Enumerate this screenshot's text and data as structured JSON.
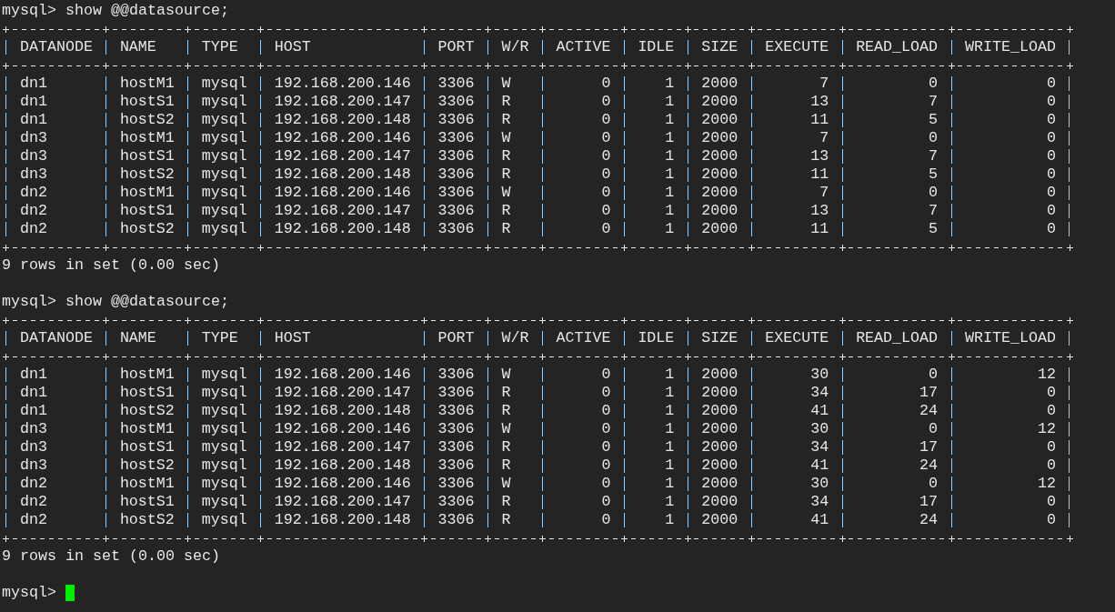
{
  "terminal": {
    "blocks": [
      {
        "kind": "command",
        "prompt": "mysql>",
        "text": "show @@datasource;"
      },
      {
        "kind": "table",
        "columns": [
          {
            "label": "DATANODE",
            "right_aligned": false
          },
          {
            "label": "NAME",
            "right_aligned": false
          },
          {
            "label": "TYPE",
            "right_aligned": false
          },
          {
            "label": "HOST",
            "right_aligned": false
          },
          {
            "label": "PORT"
          },
          {
            "label": "W/R",
            "right_aligned": false
          },
          {
            "label": "ACTIVE",
            "right_aligned": true
          },
          {
            "label": "IDLE",
            "right_aligned": true
          },
          {
            "label": "SIZE"
          },
          {
            "label": "EXECUTE",
            "right_aligned": true
          },
          {
            "label": "READ_LOAD",
            "right_aligned": true
          },
          {
            "label": "WRITE_LOAD",
            "right_aligned": true
          }
        ],
        "rows": [
          [
            "dn1",
            "hostM1",
            "mysql",
            "192.168.200.146",
            "3306",
            "W",
            "0",
            "1",
            "2000",
            "7",
            "0",
            "0"
          ],
          [
            "dn1",
            "hostS1",
            "mysql",
            "192.168.200.147",
            "3306",
            "R",
            "0",
            "1",
            "2000",
            "13",
            "7",
            "0"
          ],
          [
            "dn1",
            "hostS2",
            "mysql",
            "192.168.200.148",
            "3306",
            "R",
            "0",
            "1",
            "2000",
            "11",
            "5",
            "0"
          ],
          [
            "dn3",
            "hostM1",
            "mysql",
            "192.168.200.146",
            "3306",
            "W",
            "0",
            "1",
            "2000",
            "7",
            "0",
            "0"
          ],
          [
            "dn3",
            "hostS1",
            "mysql",
            "192.168.200.147",
            "3306",
            "R",
            "0",
            "1",
            "2000",
            "13",
            "7",
            "0"
          ],
          [
            "dn3",
            "hostS2",
            "mysql",
            "192.168.200.148",
            "3306",
            "R",
            "0",
            "1",
            "2000",
            "11",
            "5",
            "0"
          ],
          [
            "dn2",
            "hostM1",
            "mysql",
            "192.168.200.146",
            "3306",
            "W",
            "0",
            "1",
            "2000",
            "7",
            "0",
            "0"
          ],
          [
            "dn2",
            "hostS1",
            "mysql",
            "192.168.200.147",
            "3306",
            "R",
            "0",
            "1",
            "2000",
            "13",
            "7",
            "0"
          ],
          [
            "dn2",
            "hostS2",
            "mysql",
            "192.168.200.148",
            "3306",
            "R",
            "0",
            "1",
            "2000",
            "11",
            "5",
            "0"
          ]
        ]
      },
      {
        "kind": "status",
        "text": "9 rows in set (0.00 sec)"
      },
      {
        "kind": "blank"
      },
      {
        "kind": "command",
        "prompt": "mysql>",
        "text": "show @@datasource;"
      },
      {
        "kind": "table",
        "columns": [
          {
            "label": "DATANODE",
            "right_aligned": false
          },
          {
            "label": "NAME",
            "right_aligned": false
          },
          {
            "label": "TYPE",
            "right_aligned": false
          },
          {
            "label": "HOST",
            "right_aligned": false
          },
          {
            "label": "PORT"
          },
          {
            "label": "W/R",
            "right_aligned": false
          },
          {
            "label": "ACTIVE",
            "right_aligned": true
          },
          {
            "label": "IDLE",
            "right_aligned": true
          },
          {
            "label": "SIZE"
          },
          {
            "label": "EXECUTE",
            "right_aligned": true
          },
          {
            "label": "READ_LOAD",
            "right_aligned": true
          },
          {
            "label": "WRITE_LOAD",
            "right_aligned": true
          }
        ],
        "rows": [
          [
            "dn1",
            "hostM1",
            "mysql",
            "192.168.200.146",
            "3306",
            "W",
            "0",
            "1",
            "2000",
            "30",
            "0",
            "12"
          ],
          [
            "dn1",
            "hostS1",
            "mysql",
            "192.168.200.147",
            "3306",
            "R",
            "0",
            "1",
            "2000",
            "34",
            "17",
            "0"
          ],
          [
            "dn1",
            "hostS2",
            "mysql",
            "192.168.200.148",
            "3306",
            "R",
            "0",
            "1",
            "2000",
            "41",
            "24",
            "0"
          ],
          [
            "dn3",
            "hostM1",
            "mysql",
            "192.168.200.146",
            "3306",
            "W",
            "0",
            "1",
            "2000",
            "30",
            "0",
            "12"
          ],
          [
            "dn3",
            "hostS1",
            "mysql",
            "192.168.200.147",
            "3306",
            "R",
            "0",
            "1",
            "2000",
            "34",
            "17",
            "0"
          ],
          [
            "dn3",
            "hostS2",
            "mysql",
            "192.168.200.148",
            "3306",
            "R",
            "0",
            "1",
            "2000",
            "41",
            "24",
            "0"
          ],
          [
            "dn2",
            "hostM1",
            "mysql",
            "192.168.200.146",
            "3306",
            "W",
            "0",
            "1",
            "2000",
            "30",
            "0",
            "12"
          ],
          [
            "dn2",
            "hostS1",
            "mysql",
            "192.168.200.147",
            "3306",
            "R",
            "0",
            "1",
            "2000",
            "34",
            "17",
            "0"
          ],
          [
            "dn2",
            "hostS2",
            "mysql",
            "192.168.200.148",
            "3306",
            "R",
            "0",
            "1",
            "2000",
            "41",
            "24",
            "0"
          ]
        ]
      },
      {
        "kind": "status",
        "text": "9 rows in set (0.00 sec)"
      },
      {
        "kind": "blank"
      },
      {
        "kind": "prompt",
        "prompt": "mysql>",
        "cursor": true
      }
    ]
  }
}
